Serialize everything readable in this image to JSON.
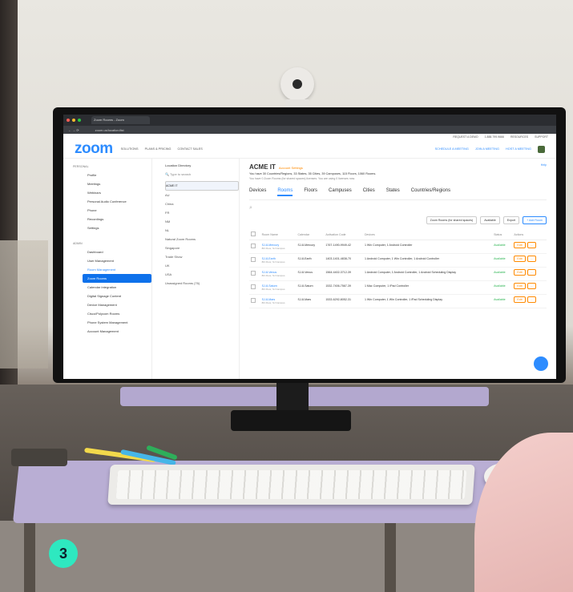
{
  "badge_number": "3",
  "colors": {
    "badge": "#2ee8c0",
    "zoom_blue": "#2d8cff",
    "accent_orange": "#ff8a00"
  },
  "browser": {
    "tab_title": "Zoom Rooms - Zoom",
    "url": "zoom.us/location/list"
  },
  "top_strip": [
    "REQUEST A DEMO",
    "1.888.799.9666",
    "RESOURCES",
    "SUPPORT"
  ],
  "nav": {
    "logo": "zoom",
    "links": [
      "SOLUTIONS",
      "PLANS & PRICING",
      "CONTACT SALES"
    ],
    "right": [
      "SCHEDULE A MEETING",
      "JOIN A MEETING",
      "HOST A MEETING"
    ]
  },
  "sidebar": {
    "personal_heading": "PERSONAL",
    "personal": [
      "Profile",
      "Meetings",
      "Webinars",
      "Personal Audio Conference",
      "Phone",
      "Recordings",
      "Settings"
    ],
    "admin_heading": "ADMIN",
    "admin": [
      "Dashboard",
      "User Management",
      "Room Management",
      "Zoom Rooms",
      "Calendar Integration",
      "Digital Signage Content",
      "Device Management",
      "Cisco/Polycom Rooms",
      "Phone System Management",
      "Account Management"
    ]
  },
  "location": {
    "title": "Location Directory",
    "search_placeholder": "Type to search",
    "items": [
      "ACME IT",
      "AU",
      "China",
      "FR",
      "NM",
      "NL",
      "Natural Zoom Rooms",
      "Singapore",
      "Trade Show",
      "UK",
      "USA",
      "Unassigned Rooms (76)"
    ]
  },
  "main": {
    "title": "ACME IT",
    "account_settings": "Account Settings",
    "help": "Help",
    "summary": "You have 30 Countries/Regions, 33 States, 35 Cities, 39 Campuses, 115 Floors, 1060 Rooms.",
    "licenses": "You have 0 Zoom Rooms (for shared spaces) licenses. You are using 0 licenses now.",
    "tabs": [
      "Devices",
      "Rooms",
      "Floors",
      "Campuses",
      "Cities",
      "States",
      "Countries/Regions"
    ],
    "filter_type": "Zoom Rooms (for shared spaces)",
    "filter_status": "Available",
    "export": "Export",
    "add_room": "+ Add Room",
    "columns": [
      "Room Name",
      "Calendar",
      "Activation Code",
      "Devices",
      "Status",
      "Actions"
    ],
    "rows": [
      {
        "name": "SJ-8-Mercury",
        "sub": "8th Floor, SJ Campus",
        "calendar": "SJ-8-Mercury",
        "code": "1767-1490-9949-42",
        "devices": "1 Win Computer, 1 Android Controller",
        "status": "Available"
      },
      {
        "name": "SJ-8-Earth",
        "sub": "8th Floor, SJ Campus",
        "calendar": "SJ-8-Earth",
        "code": "1403-1401-4838-70",
        "devices": "1 Android Computer, 1 Win Controller, 1 Android Controller",
        "status": "Available"
      },
      {
        "name": "SJ-8-Venus",
        "sub": "8th Floor, SJ Campus",
        "calendar": "SJ-8-Venus",
        "code": "1564-4402-3712-39",
        "devices": "1 Android Computer, 1 Android Controller, 1 Android Scheduling Display",
        "status": "Available"
      },
      {
        "name": "SJ-8-Saturn",
        "sub": "8th Floor, SJ Campus",
        "calendar": "SJ-8-Saturn",
        "code": "1532-7406-7567-39",
        "devices": "1 Mac Computer, 1 iPad Controller",
        "status": "Available"
      },
      {
        "name": "SJ-8-Mars",
        "sub": "8th Floor, SJ Campus",
        "calendar": "SJ-8-Mars",
        "code": "1533-6292-8052-31",
        "devices": "1 Win Computer, 1 Win Controller, 1 iPad Scheduling Display",
        "status": "Available"
      }
    ],
    "edit": "Edit",
    "more": "..."
  }
}
